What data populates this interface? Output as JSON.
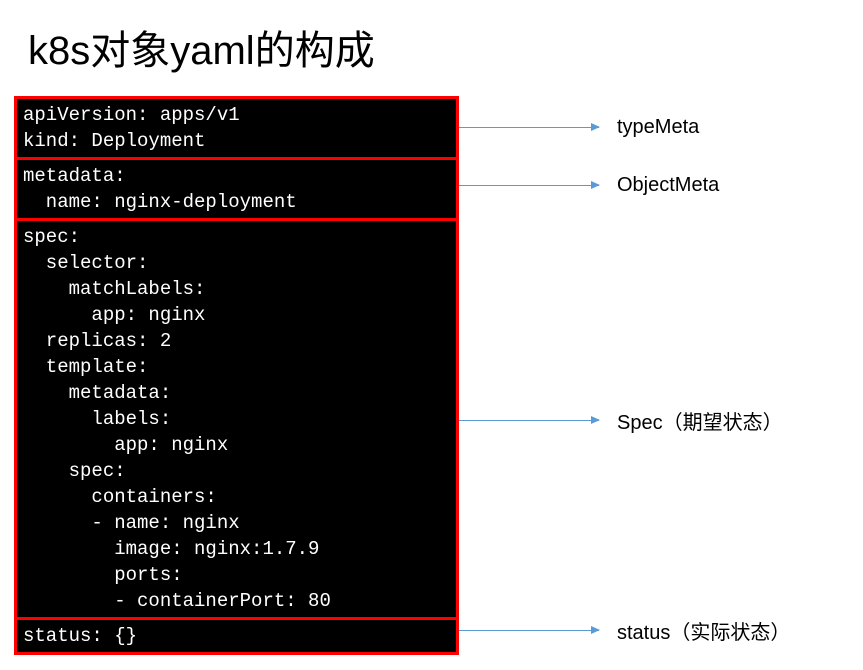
{
  "title": "k8s对象yaml的构成",
  "blocks": {
    "typeMeta": {
      "lines": [
        "apiVersion: apps/v1",
        "kind: Deployment"
      ],
      "label": "typeMeta"
    },
    "objectMeta": {
      "lines": [
        "metadata:",
        "  name: nginx-deployment"
      ],
      "label": "ObjectMeta"
    },
    "spec": {
      "lines": [
        "spec:",
        "  selector:",
        "    matchLabels:",
        "      app: nginx",
        "  replicas: 2",
        "  template:",
        "    metadata:",
        "      labels:",
        "        app: nginx",
        "    spec:",
        "      containers:",
        "      - name: nginx",
        "        image: nginx:1.7.9",
        "        ports:",
        "        - containerPort: 80"
      ],
      "label": "Spec（期望状态）"
    },
    "status": {
      "lines": [
        "status: {}"
      ],
      "label": "status（实际状态）"
    }
  }
}
